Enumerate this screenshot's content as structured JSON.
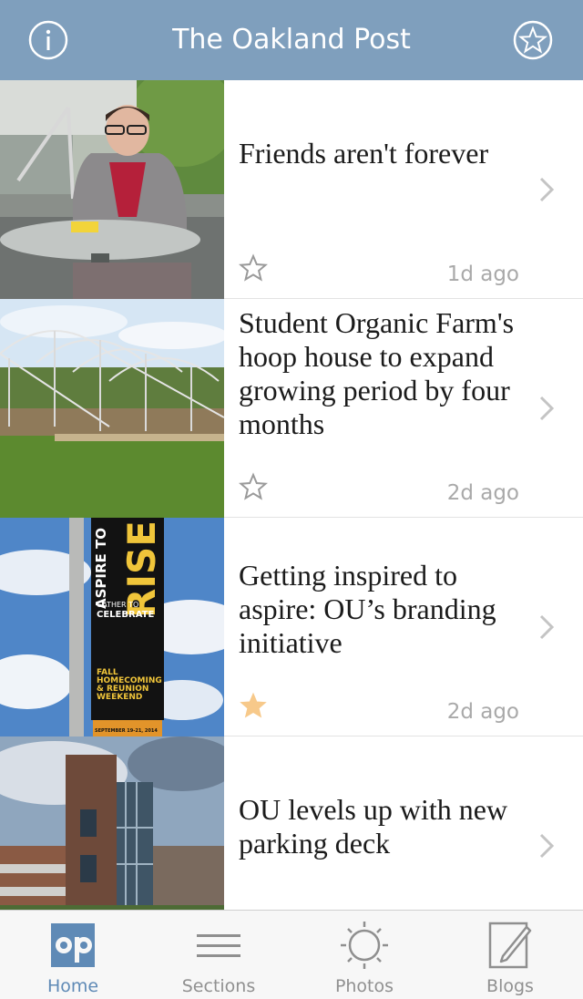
{
  "header": {
    "title": "The Oakland Post",
    "info_icon": "info-circle-icon",
    "favorites_icon": "star-circle-icon"
  },
  "articles": [
    {
      "headline": "Friends aren't forever",
      "age": "1d ago",
      "favorited": false,
      "image": "student-at-table-photo"
    },
    {
      "headline": "Student Organic Farm's hoop house to expand growing period by four months",
      "age": "2d ago",
      "favorited": false,
      "image": "hoop-house-photo"
    },
    {
      "headline": "Getting inspired to aspire: OU’s branding initiative",
      "age": "2d ago",
      "favorited": true,
      "image": "aspire-to-rise-banner-photo"
    },
    {
      "headline": "OU levels up with new parking deck",
      "age": "",
      "favorited": false,
      "image": "parking-deck-photo"
    }
  ],
  "banner_text": {
    "top": "ASPIRE TO",
    "big": "RISE",
    "mid1": "GATHER TO",
    "mid2": "CELEBRATE",
    "low1": "FALL",
    "low2": "HOMECOMING",
    "low3": "& REUNION",
    "low4": "WEEKEND",
    "date": "SEPTEMBER 19-21, 2014"
  },
  "tabs": [
    {
      "label": "Home",
      "icon": "op-logo-icon",
      "active": true
    },
    {
      "label": "Sections",
      "icon": "menu-lines-icon",
      "active": false
    },
    {
      "label": "Photos",
      "icon": "aperture-sun-icon",
      "active": false
    },
    {
      "label": "Blogs",
      "icon": "pencil-paper-icon",
      "active": false
    }
  ],
  "colors": {
    "header_bg": "#7f9fbd",
    "accent": "#5f8ab6",
    "favorite_star": "#f7c98a",
    "timestamp": "#a9a9a9"
  }
}
